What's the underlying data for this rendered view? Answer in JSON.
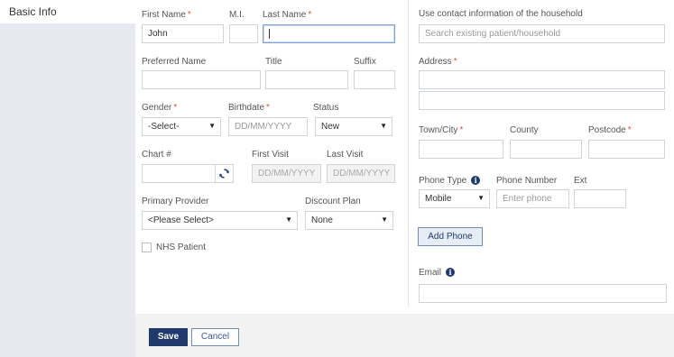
{
  "sidebar": {
    "tab_label": "Basic Info"
  },
  "form": {
    "first_name": {
      "label": "First Name",
      "required": "*",
      "value": "John"
    },
    "mi": {
      "label": "M.I.",
      "value": ""
    },
    "last_name": {
      "label": "Last Name",
      "required": "*",
      "value": ""
    },
    "preferred_name": {
      "label": "Preferred Name",
      "value": ""
    },
    "title": {
      "label": "Title",
      "value": ""
    },
    "suffix": {
      "label": "Suffix",
      "value": ""
    },
    "gender": {
      "label": "Gender",
      "required": "*",
      "selected": "-Select-"
    },
    "birthdate": {
      "label": "Birthdate",
      "required": "*",
      "placeholder": "DD/MM/YYYY"
    },
    "status": {
      "label": "Status",
      "selected": "New"
    },
    "chart": {
      "label": "Chart #",
      "value": ""
    },
    "first_visit": {
      "label": "First Visit",
      "placeholder": "DD/MM/YYYY"
    },
    "last_visit": {
      "label": "Last Visit",
      "placeholder": "DD/MM/YYYY"
    },
    "primary_provider": {
      "label": "Primary Provider",
      "selected": "<Please Select>"
    },
    "discount_plan": {
      "label": "Discount Plan",
      "selected": "None"
    },
    "nhs_patient": {
      "label": "NHS Patient",
      "checked": false
    }
  },
  "contact": {
    "household_label": "Use contact information of the household",
    "household_placeholder": "Search existing patient/household",
    "address_label": "Address",
    "address_required": "*",
    "town_label": "Town/City",
    "town_required": "*",
    "county_label": "County",
    "postcode_label": "Postcode",
    "postcode_required": "*",
    "phone_type_label": "Phone Type",
    "phone_type_selected": "Mobile",
    "phone_number_label": "Phone Number",
    "phone_placeholder": "Enter phone",
    "ext_label": "Ext",
    "add_phone_label": "Add Phone",
    "email_label": "Email",
    "info_glyph": "i"
  },
  "footer": {
    "save_label": "Save",
    "cancel_label": "Cancel"
  },
  "icons": {
    "caret": "▼",
    "refresh": "refresh-icon",
    "info": "info-icon"
  },
  "colors": {
    "primary": "#1f3a6b",
    "required": "#d9534f",
    "sidebar": "#e6e9f0",
    "footer": "#f2f2f2"
  }
}
